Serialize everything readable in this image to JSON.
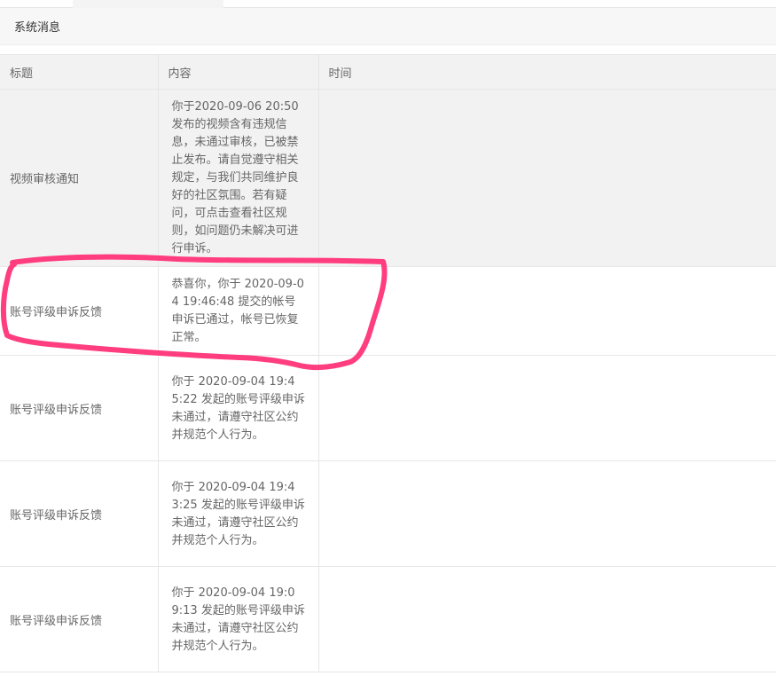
{
  "panel": {
    "title": "系统消息"
  },
  "table": {
    "headers": {
      "title": "标题",
      "content": "内容",
      "time": "时间"
    },
    "rows": [
      {
        "title": "视频审核通知",
        "content": "你于2020-09-06 20:50发布的视频含有违规信息，未通过审核，已被禁止发布。请自觉遵守相关规定，与我们共同维护良好的社区氛围。若有疑问，可点击查看社区规则，如问题仍未解决可进行申诉。",
        "time": ""
      },
      {
        "title": "账号评级申诉反馈",
        "content": "恭喜你，你于 2020-09-04 19:46:48 提交的帐号申诉已通过，帐号已恢复正常。",
        "time": ""
      },
      {
        "title": "账号评级申诉反馈",
        "content": "你于 2020-09-04 19:45:22 发起的账号评级申诉未通过，请遵守社区公约并规范个人行为。",
        "time": ""
      },
      {
        "title": "账号评级申诉反馈",
        "content": "你于 2020-09-04 19:43:25 发起的账号评级申诉未通过，请遵守社区公约并规范个人行为。",
        "time": ""
      },
      {
        "title": "账号评级申诉反馈",
        "content": "你于 2020-09-04 19:09:13 发起的账号评级申诉未通过，请遵守社区公约并规范个人行为。",
        "time": ""
      }
    ]
  },
  "colors": {
    "annotation_stroke": "#ff3d7f",
    "header_bg": "#f2f2f2",
    "border": "#e6e6e6"
  }
}
